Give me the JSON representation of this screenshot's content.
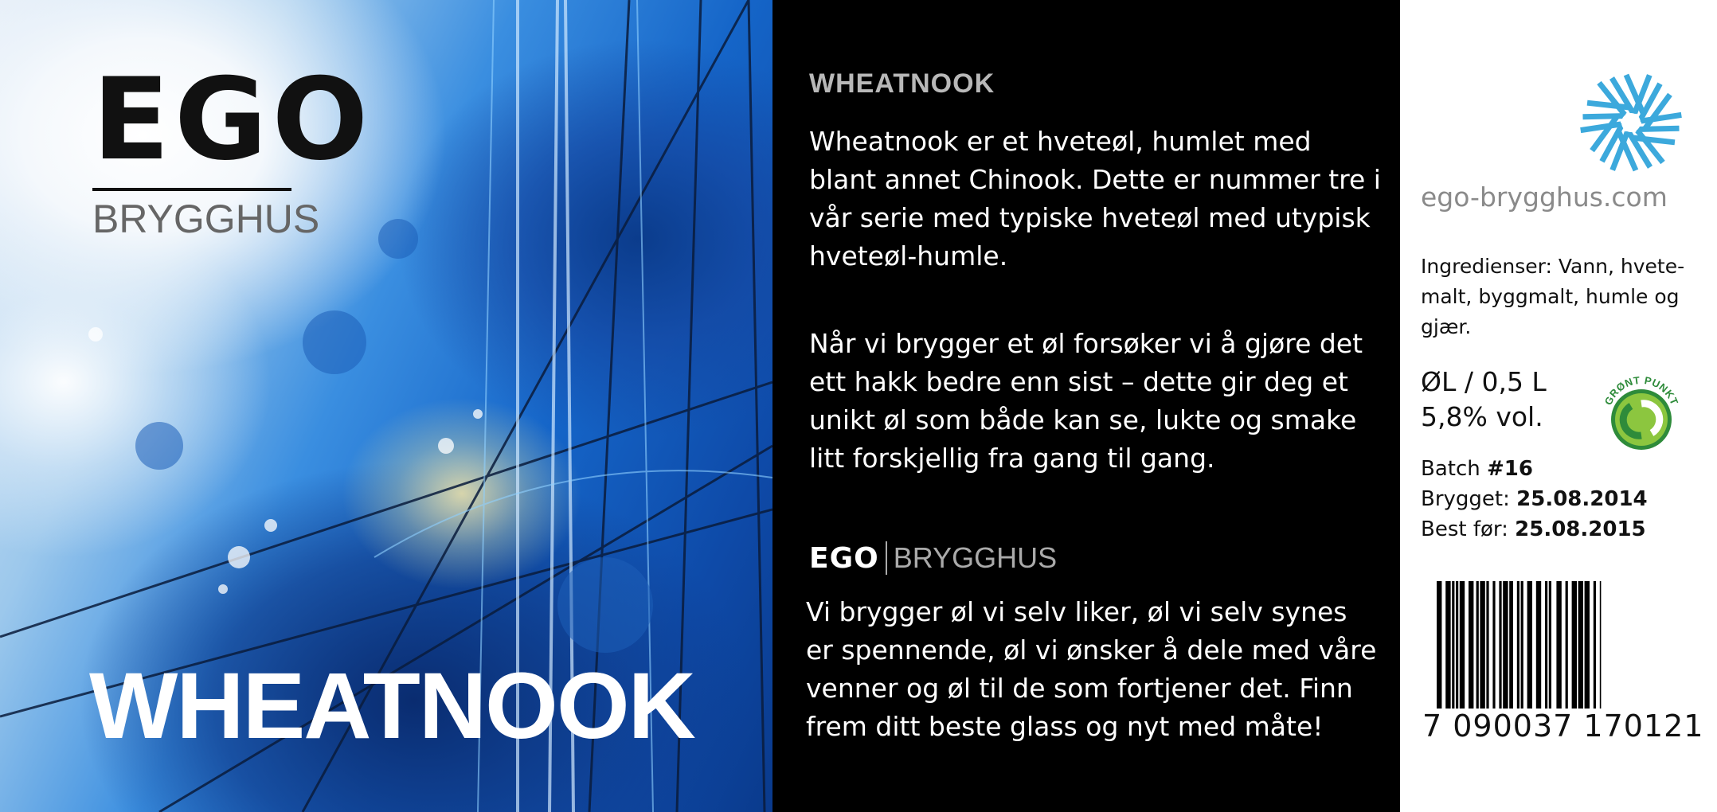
{
  "brand": {
    "logo_word": "EGO",
    "logo_sub": "BRYGGHUS"
  },
  "beer_name": "WHEATNOOK",
  "description": {
    "heading": "WHEATNOOK",
    "paragraph_1": "Wheatnook er et hveteøl, humlet med blant annet Chinook. Dette er nummer tre i vår serie med typiske hveteøl med utypisk hveteøl-humle.",
    "paragraph_2": "Når vi brygger et øl forsøker vi å gjøre det ett hakk bedre enn sist – dette gir deg et unikt øl som både kan se, lukte og smake litt forskjellig fra gang til gang.",
    "brewery_blurb": "Vi brygger øl vi selv liker, øl vi selv synes er spennende, øl vi ønsker å dele med våre venner og øl til de som fortjener det. Finn frem ditt beste glass og nyt med måte!"
  },
  "info": {
    "website": "ego-brygghus.com",
    "ingredients": "Ingredienser: Vann, hvete-malt, byggmalt, humle og gjær.",
    "type_volume": "ØL / 0,5 L",
    "abv": "5,8% vol.",
    "batch_label": "Batch",
    "batch_value": "#16",
    "brewed_label": "Brygget:",
    "brewed_value": "25.08.2014",
    "best_before_label": "Best før:",
    "best_before_value": "25.08.2015",
    "recycling_logo_text": "GRØNT PUNKT",
    "barcode_number": "7 090037 170121"
  },
  "colors": {
    "fan_logo": "#3ca9dc",
    "green_dot_outer": "#2e8b3a",
    "green_dot_inner": "#8cc63f",
    "middle_panel_bg": "#000000",
    "right_panel_bg": "#ffffff"
  },
  "icons": {
    "brand_symbol": "blue-fan-swirl-icon",
    "recycling": "green-dot-recycling-icon"
  }
}
